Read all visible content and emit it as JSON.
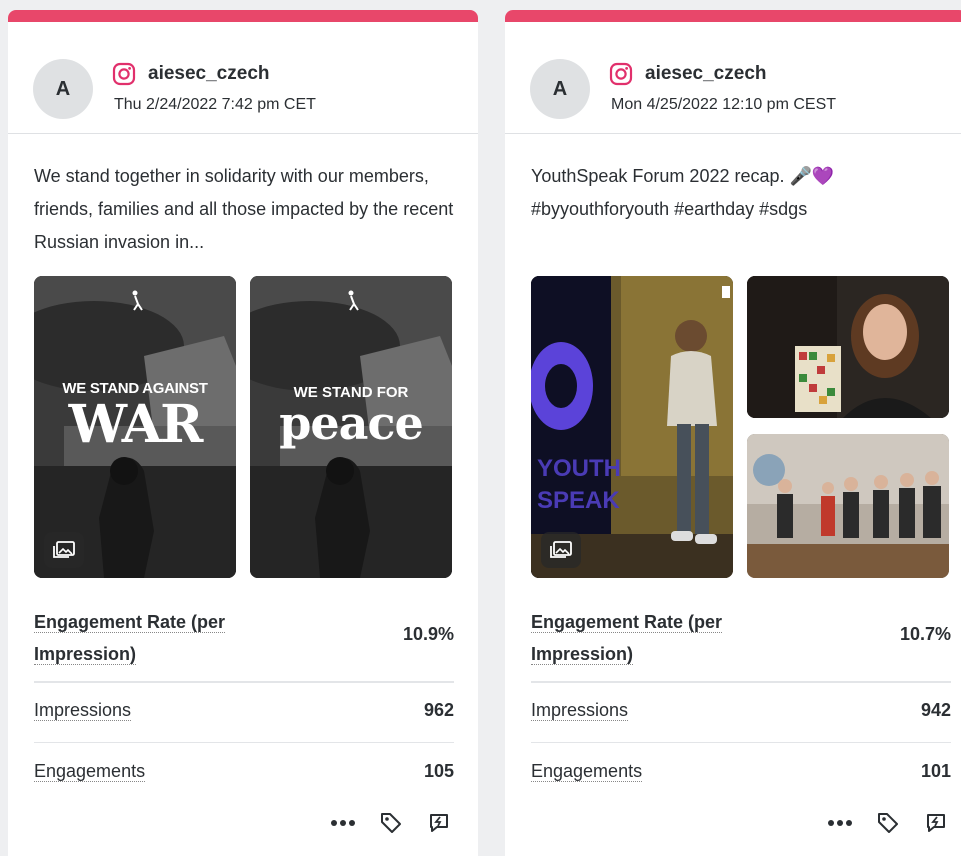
{
  "cards": [
    {
      "avatar_letter": "A",
      "handle": "aiesec_czech",
      "date": "Thu 2/24/2022 7:42 pm CET",
      "text": "We stand together in solidarity with our members, friends, families and all those impacted by the recent Russian invasion in...",
      "images": [
        {
          "line1": "WE STAND AGAINST",
          "line2": "WAR"
        },
        {
          "line1": "WE STAND FOR",
          "line2": "peace"
        }
      ],
      "metrics": {
        "engagement_rate_label": "Engagement Rate (per Impression)",
        "engagement_rate_value": "10.9%",
        "impressions_label": "Impressions",
        "impressions_value": "962",
        "engagements_label": "Engagements",
        "engagements_value": "105"
      },
      "colors": {
        "accent": "#e8476a",
        "instagram": "#e1306c"
      }
    },
    {
      "avatar_letter": "A",
      "handle": "aiesec_czech",
      "date": "Mon 4/25/2022 12:10 pm CEST",
      "text": "YouthSpeak Forum 2022 recap. 🎤💜 #byyouthforyouth #earthday #sdgs",
      "metrics": {
        "engagement_rate_label": "Engagement Rate (per Impression)",
        "engagement_rate_value": "10.7%",
        "impressions_label": "Impressions",
        "impressions_value": "942",
        "engagements_label": "Engagements",
        "engagements_value": "101"
      }
    }
  ],
  "actions": {
    "icons": [
      "more-icon",
      "tag-icon",
      "reply-icon"
    ]
  }
}
